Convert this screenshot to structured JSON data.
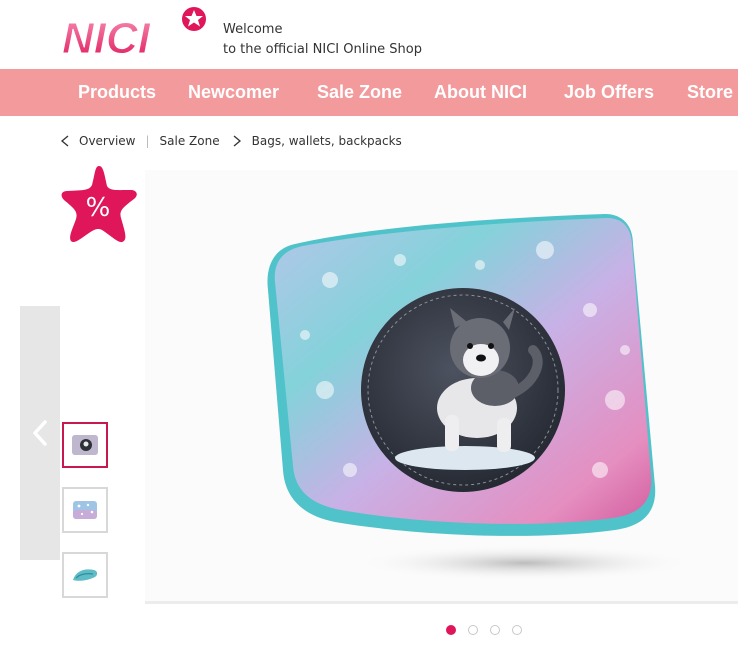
{
  "header": {
    "logo_text": "NICI",
    "welcome_line1": "Welcome",
    "welcome_line2": "to the official NICI Online Shop"
  },
  "nav": {
    "items": [
      "Products",
      "Newcomer",
      "Sale Zone",
      "About NICI",
      "Job Offers",
      "Store Locator"
    ]
  },
  "breadcrumb": {
    "items": [
      "Overview",
      "Sale Zone",
      "Bags, wallets, backpacks"
    ]
  },
  "sale_badge": {
    "symbol": "%"
  },
  "gallery": {
    "thumbnail_count": 3,
    "active_thumbnail": 1,
    "dots_count": 4,
    "active_dot": 1
  },
  "colors": {
    "nav_bg": "#f39a9d",
    "accent": "#e0165a",
    "active_thumb_border": "#c8194e"
  }
}
